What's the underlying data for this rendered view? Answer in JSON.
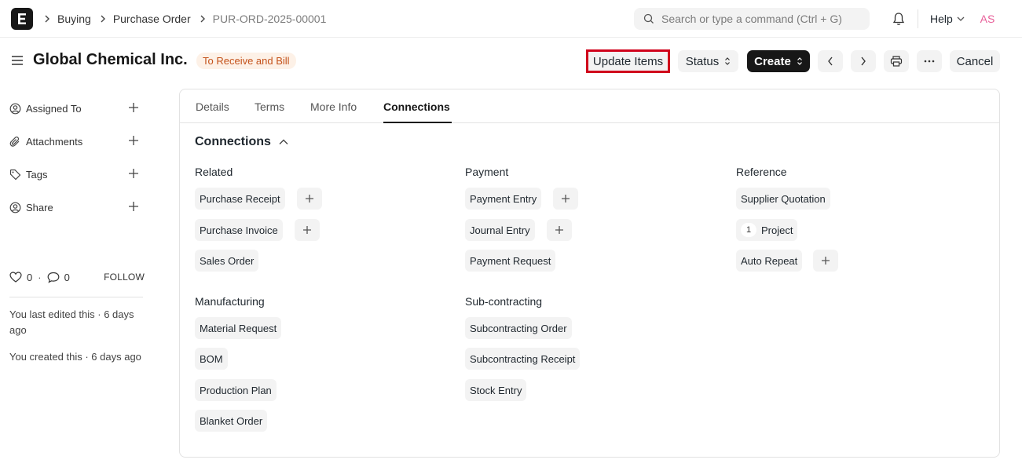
{
  "navbar": {
    "breadcrumbs": [
      "Buying",
      "Purchase Order",
      "PUR-ORD-2025-00001"
    ],
    "search_placeholder": "Search or type a command (Ctrl + G)",
    "help_label": "Help",
    "avatar_initials": "AS",
    "avatar_color": "#e8609a"
  },
  "header": {
    "title": "Global Chemical Inc.",
    "status": "To Receive and Bill",
    "status_color": "#c4521b",
    "buttons": {
      "update_items": "Update Items",
      "status": "Status",
      "create": "Create",
      "cancel": "Cancel"
    },
    "icons": [
      "hamburger-icon",
      "chevron-left-icon",
      "chevron-right-icon",
      "printer-icon",
      "ellipsis-icon"
    ]
  },
  "sidebar": {
    "items": [
      {
        "label": "Assigned To",
        "icon": "assign-user-icon"
      },
      {
        "label": "Attachments",
        "icon": "paperclip-icon"
      },
      {
        "label": "Tags",
        "icon": "tag-icon"
      },
      {
        "label": "Share",
        "icon": "share-user-icon"
      }
    ],
    "likes": "0",
    "comments": "0",
    "follow_label": "FOLLOW",
    "last_edited": "You last edited this · 6 days ago",
    "created": "You created this · 6 days ago"
  },
  "tabs": [
    "Details",
    "Terms",
    "More Info",
    "Connections"
  ],
  "active_tab": "Connections",
  "connections": {
    "title": "Connections",
    "groups": {
      "related": {
        "title": "Related",
        "items": [
          "Purchase Receipt",
          "Purchase Invoice",
          "Sales Order"
        ]
      },
      "payment": {
        "title": "Payment",
        "items": [
          "Payment Entry",
          "Journal Entry",
          "Payment Request"
        ]
      },
      "reference": {
        "title": "Reference",
        "items": [
          "Supplier Quotation",
          "Project",
          "Auto Repeat"
        ],
        "project_count": "1"
      },
      "manufacturing": {
        "title": "Manufacturing",
        "items": [
          "Material Request",
          "BOM",
          "Production Plan",
          "Blanket Order"
        ]
      },
      "subcontracting": {
        "title": "Sub-contracting",
        "items": [
          "Subcontracting Order",
          "Subcontracting Receipt",
          "Stock Entry"
        ]
      }
    }
  },
  "highlight_color": "#d0021b"
}
